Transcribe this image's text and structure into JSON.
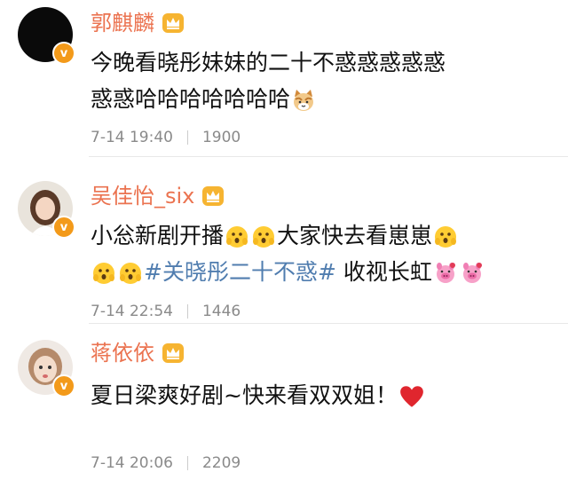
{
  "comments": [
    {
      "name": "郭麒麟",
      "text_parts": [
        "今晚看晓彤妹妹的二十不惑惑惑惑惑",
        "惑惑哈哈哈哈哈哈哈"
      ],
      "emoji": [
        "cat-face-icon"
      ],
      "date": "7-14 19:40",
      "likes": "1900"
    },
    {
      "name": "吴佳怡_six",
      "text_parts": [
        "小忩新剧开播",
        "大家快去看崽崽",
        "收视长虹"
      ],
      "topic": "#关晓彤二十不惑#",
      "emoji": [
        "hushed-face-icon",
        "pig-icon"
      ],
      "date": "7-14 22:54",
      "likes": "1446"
    },
    {
      "name": "蒋依依",
      "text_parts": [
        "夏日梁爽好剧~快来看双双姐！"
      ],
      "emoji": [
        "red-heart-icon"
      ],
      "date": "7-14 20:06",
      "likes": "2209"
    }
  ],
  "badge_letter": "v",
  "colors": {
    "name": "#eb7350",
    "topic": "#507daf",
    "badge": "#f39a1a",
    "crown": "#f6b431"
  }
}
